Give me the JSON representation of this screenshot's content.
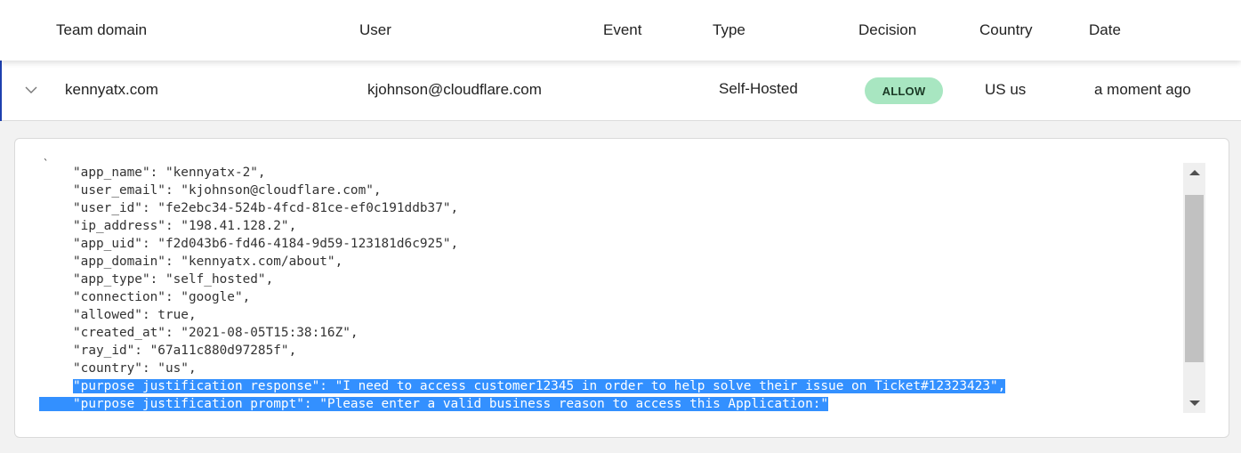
{
  "table": {
    "columns": [
      {
        "key": "team_domain",
        "label": "Team domain"
      },
      {
        "key": "user",
        "label": "User"
      },
      {
        "key": "event",
        "label": "Event"
      },
      {
        "key": "type",
        "label": "Type"
      },
      {
        "key": "decision",
        "label": "Decision"
      },
      {
        "key": "country",
        "label": "Country"
      },
      {
        "key": "date",
        "label": "Date"
      }
    ],
    "rows": [
      {
        "expanded": true,
        "expand_icon": "chevron-down-icon",
        "team_domain": "kennyatx.com",
        "user": "kjohnson@cloudflare.com",
        "event": "",
        "type": "Self-Hosted",
        "decision": "ALLOW",
        "decision_color": "#a8e6c1",
        "country": "US us",
        "date": "a moment ago"
      }
    ]
  },
  "details": {
    "leading_char": "`",
    "lines": [
      "\"app_name\": \"kennyatx-2\",",
      "\"user_email\": \"kjohnson@cloudflare.com\",",
      "\"user_id\": \"fe2ebc34-524b-4fcd-81ce-ef0c191ddb37\",",
      "\"ip_address\": \"198.41.128.2\",",
      "\"app_uid\": \"f2d043b6-fd46-4184-9d59-123181d6c925\",",
      "\"app_domain\": \"kennyatx.com/about\",",
      "\"app_type\": \"self_hosted\",",
      "\"connection\": \"google\",",
      "\"allowed\": true,",
      "\"created_at\": \"2021-08-05T15:38:16Z\",",
      "\"ray_id\": \"67a11c880d97285f\",",
      "\"country\": \"us\","
    ],
    "selected_lines": [
      "\"purpose justification response\": \"I need to access customer12345 in order to help solve their issue on Ticket#12323423\",",
      "\"purpose justification prompt\": \"Please enter a valid business reason to access this Application:\""
    ],
    "selection_color": "#3390ff"
  }
}
